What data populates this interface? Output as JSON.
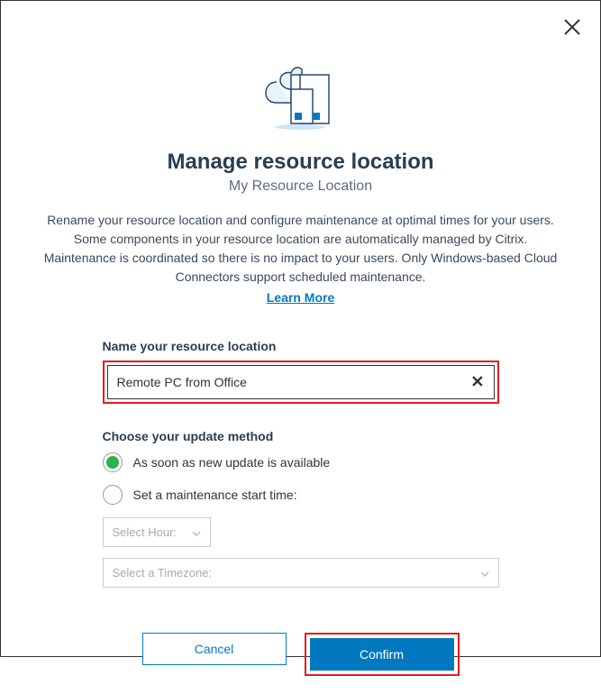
{
  "modal": {
    "title": "Manage resource location",
    "subtitle": "My Resource Location",
    "description": "Rename your resource location and configure maintenance at optimal times for your users. Some components in your resource location are automatically managed by Citrix. Maintenance is coordinated so there is no impact to your users. Only Windows-based Cloud Connectors support scheduled maintenance.",
    "learn_more": "Learn More"
  },
  "form": {
    "name_label": "Name your resource location",
    "name_value": "Remote PC from Office",
    "update_label": "Choose your update method",
    "option_asap": "As soon as new update is available",
    "option_scheduled": "Set a maintenance start time:",
    "select_hour_placeholder": "Select Hour:",
    "select_timezone_placeholder": "Select a Timezone:"
  },
  "buttons": {
    "cancel": "Cancel",
    "confirm": "Confirm"
  }
}
